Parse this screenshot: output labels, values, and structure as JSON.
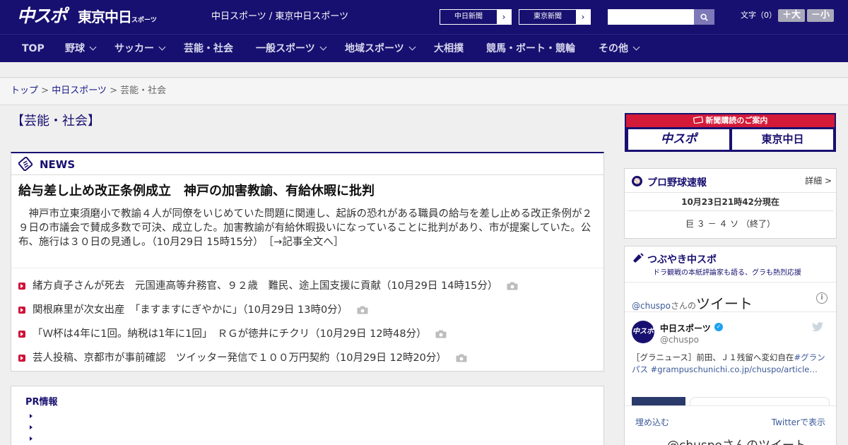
{
  "header": {
    "logo_chuspo": "中スポ",
    "logo_tokyo": "東京中日",
    "logo_tokyo_suffix": "スポーツ",
    "site_names": "中日スポーツ / 東京中日スポーツ",
    "link_chunichi": "中日新聞",
    "link_tokyo": "東京新聞",
    "search_placeholder": "",
    "fontsize_label": "文字（0）",
    "fontsize_big": "＋大",
    "fontsize_small": "－小"
  },
  "nav": {
    "items": [
      {
        "label": "TOP",
        "dropdown": false
      },
      {
        "label": "野球",
        "dropdown": true
      },
      {
        "label": "サッカー",
        "dropdown": true
      },
      {
        "label": "芸能・社会",
        "dropdown": false
      },
      {
        "label": "一般スポーツ",
        "dropdown": true
      },
      {
        "label": "地域スポーツ",
        "dropdown": true
      },
      {
        "label": "大相撲",
        "dropdown": false
      },
      {
        "label": "競馬・ボート・競輪",
        "dropdown": false
      },
      {
        "label": "その他",
        "dropdown": true
      }
    ]
  },
  "breadcrumb": {
    "home": "トップ",
    "sep1": " > ",
    "section": "中日スポーツ",
    "sep2": " > ",
    "current": "芸能・社会"
  },
  "page": {
    "title": "【芸能・社会】"
  },
  "news": {
    "label": "NEWS",
    "lead_title": "給与差し止め改正条例成立　神戸の加害教諭、有給休暇に批判",
    "lead_body": "神戸市立東須磨小で教諭４人が同僚をいじめていた問題に関連し、起訴の恐れがある職員の給与を差し止める改正条例が２９日の市議会で賛成多数で可決、成立した。加害教諭が有給休暇扱いになっていることに批判があり、市が提案していた。公布、施行は３０日の見通し。（10月29日 15時15分）",
    "lead_more": "［→記事全文へ］",
    "items": [
      {
        "title": "緒方貞子さんが死去　元国連高等弁務官、９２歳　難民、途上国支援に貢献",
        "time": "（10月29日 14時15分）"
      },
      {
        "title": "関根麻里が次女出産　「ますますにぎやかに」",
        "time": "（10月29日 13時0分）"
      },
      {
        "title": "「Ｗ杯は4年に1回。納税は1年に1回」　ＲＧが徳井にチクリ",
        "time": "（10月29日 12時48分）"
      },
      {
        "title": "芸人投稿、京都市が事前確認　ツイッター発信で１００万円契約",
        "time": "（10月29日 12時20分）"
      }
    ]
  },
  "pr": {
    "title": "PR情報"
  },
  "sidebar": {
    "subscribe_title": "新聞購読のご案内",
    "subscribe_logo1": "中スポ",
    "subscribe_logo2": "東京中日",
    "baseball": {
      "title": "プロ野球速報",
      "detail": "詳細 >",
      "time": "10月23日21時42分現在",
      "score": "巨 ３ － ４ ソ （終了）"
    },
    "twitter": {
      "title": "つぶやき中スポ",
      "subtitle": "ドラ観戦の本紙評論家も語る、グラも熱烈応援",
      "handle": "@chuspo",
      "handle_suffix": "さんの",
      "header_word": "ツイート",
      "avatar_text": "中スポ",
      "name": "中日スポーツ",
      "username": "@chuspo",
      "tweet_plain": "［グラニュース］前田、Ｊ１残留へ変幻自在",
      "tweet_tag1": "#グランパス",
      "tweet_link": "#grampuschunichi.co.jp/chuspo/article…",
      "embed": "埋め込む",
      "view_on": "Twitterで表示",
      "next_header": "@chuspoさんのツイート"
    }
  },
  "colors": {
    "brand": "#181070",
    "accent": "#d41a38"
  }
}
